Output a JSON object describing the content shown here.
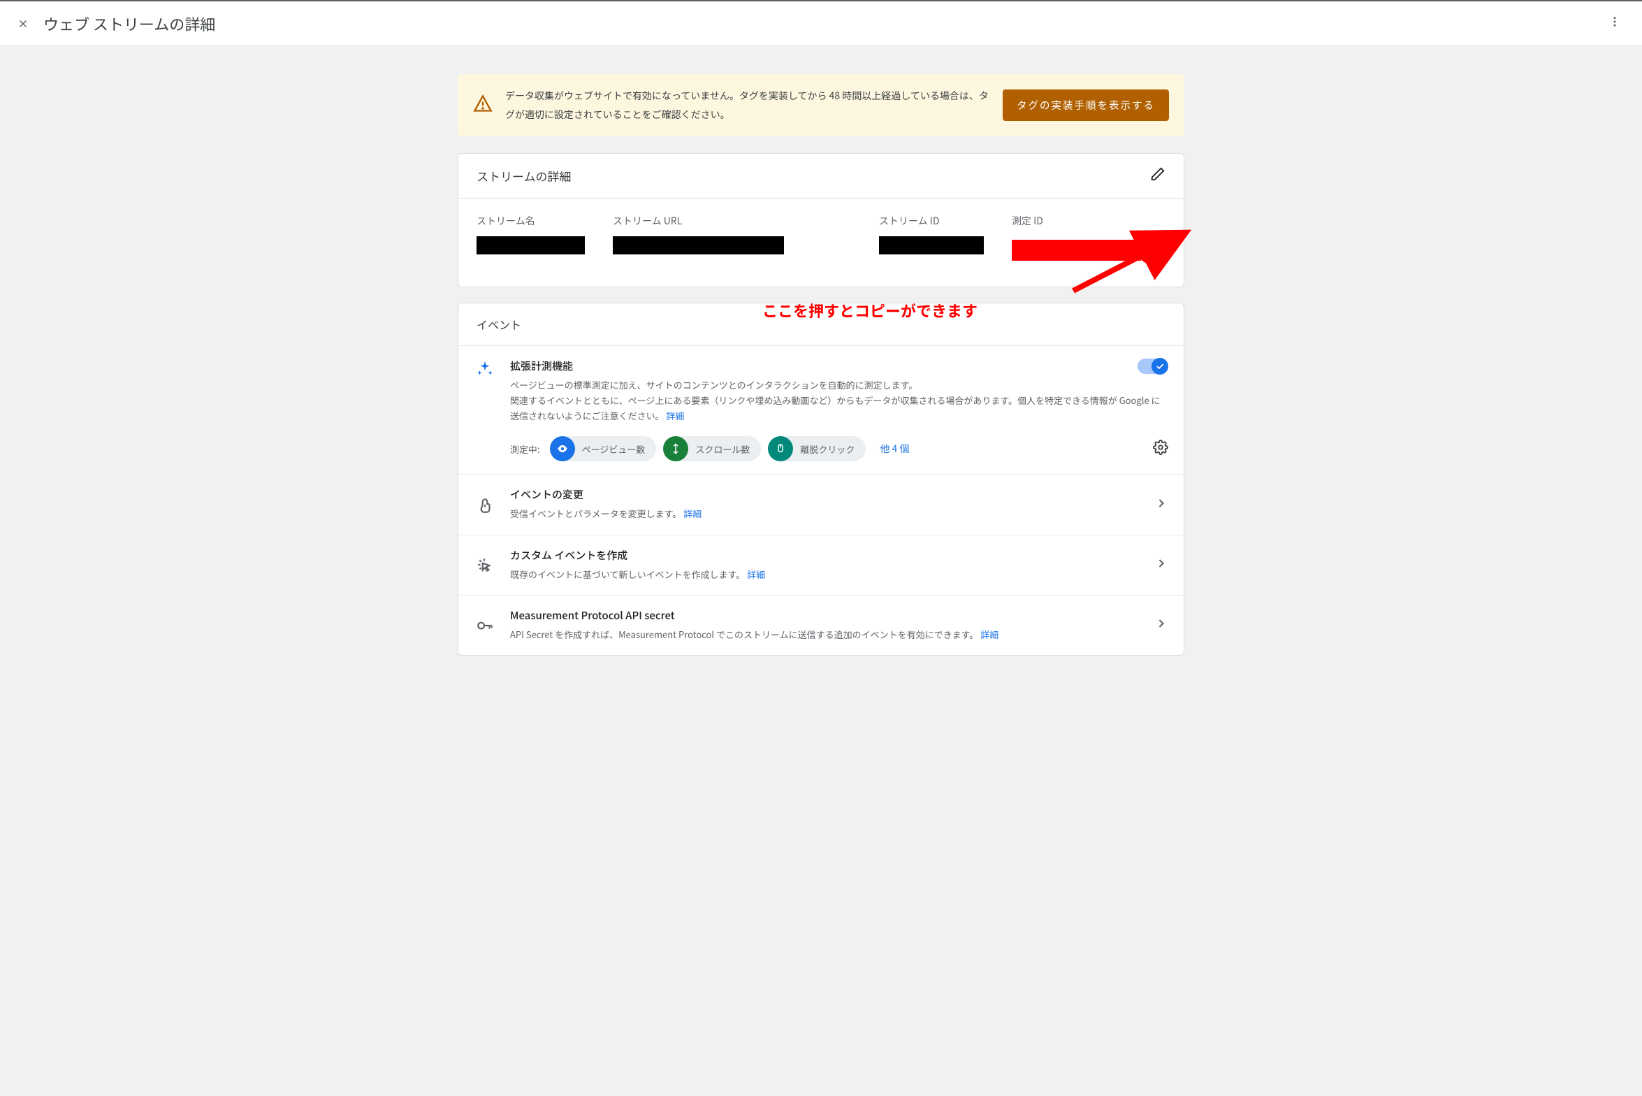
{
  "header": {
    "title": "ウェブ ストリームの詳細"
  },
  "alert": {
    "text": "データ収集がウェブサイトで有効になっていません。タグを実装してから 48 時間以上経過している場合は、タグが適切に設定されていることをご確認ください。",
    "button": "タグの実装手順を表示する"
  },
  "stream_details": {
    "title": "ストリームの詳細",
    "labels": {
      "name": "ストリーム名",
      "url": "ストリーム URL",
      "id": "ストリーム ID",
      "measurement": "測定 ID"
    }
  },
  "annotation": {
    "text": "ここを押すとコピーができます"
  },
  "events_section": {
    "title": "イベント"
  },
  "enhanced_measurement": {
    "title": "拡張計測機能",
    "desc1": "ページビューの標準測定に加え、サイトのコンテンツとのインタラクションを自動的に測定します。",
    "desc2": "関連するイベントとともに、ページ上にある要素（リンクや埋め込み動画など）からもデータが収集される場合があります。個人を特定できる情報が Google に送信されないようにご注意ください。",
    "detail_link": "詳細",
    "measuring_label": "測定中:",
    "chips": {
      "pageview": "ページビュー数",
      "scroll": "スクロール数",
      "outbound": "離脱クリック"
    },
    "plus_text": "他 4 個"
  },
  "modify_events": {
    "title": "イベントの変更",
    "desc": "受信イベントとパラメータを変更します。",
    "link": "詳細"
  },
  "custom_events": {
    "title": "カスタム イベントを作成",
    "desc": "既存のイベントに基づいて新しいイベントを作成します。",
    "link": "詳細"
  },
  "mp_secret": {
    "title": "Measurement Protocol API secret",
    "desc": "API Secret を作成すれば、Measurement Protocol でこのストリームに送信する追加のイベントを有効にできます。",
    "link": "詳細"
  }
}
